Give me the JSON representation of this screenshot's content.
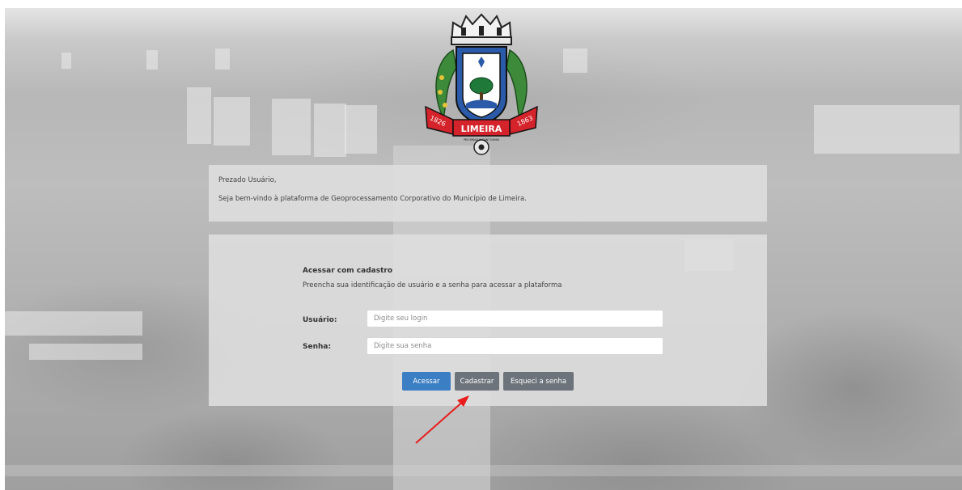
{
  "logo": {
    "text": "LIMEIRA",
    "year_left": "1826",
    "year_right": "1863",
    "motto": "PRO BRASILIA FIANT EXIMIA",
    "colors": {
      "ribbon": "#d4232b",
      "shield_blue": "#2a5aa8",
      "tree": "#1f7a3a",
      "laurel": "#3d8a3a"
    }
  },
  "welcome": {
    "greeting": "Prezado Usuário,",
    "message": "Seja bem-vindo à plataforma de Geoprocessamento Corporativo do Município de Limeira."
  },
  "login": {
    "title": "Acessar com cadastro",
    "subtitle": "Preencha sua identificação de usuário e a senha para acessar a plataforma",
    "user_label": "Usuário:",
    "user_placeholder": "Digite seu login",
    "user_value": "",
    "password_label": "Senha:",
    "password_placeholder": "Digite sua senha",
    "password_value": ""
  },
  "buttons": {
    "access": "Acessar",
    "register": "Cadastrar",
    "forgot": "Esqueci a senha"
  },
  "colors": {
    "primary": "#3b7ec4",
    "secondary": "#6c737a",
    "arrow": "#e81c1c"
  }
}
